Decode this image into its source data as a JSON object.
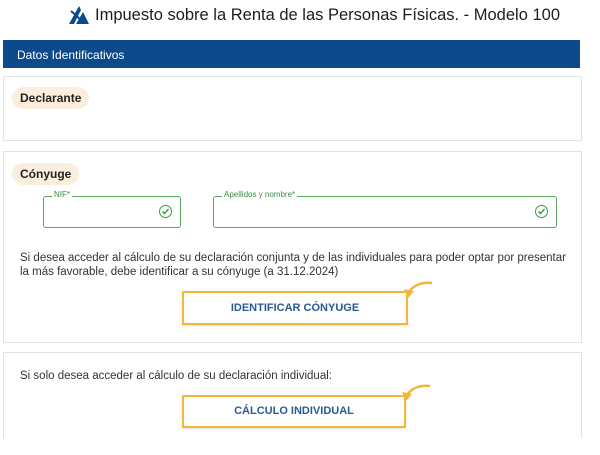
{
  "header": {
    "title": "Impuesto sobre la Renta de las Personas Físicas. - Modelo 100",
    "logo_icon": "aeat-logo"
  },
  "section": {
    "title": "Datos Identificativos"
  },
  "declarante": {
    "label": "Declarante"
  },
  "conyuge": {
    "label": "Cónyuge",
    "nif_label": "NIF*",
    "nif_value": "",
    "name_label": "Apellidos y nombre*",
    "name_value": "",
    "info_text": "Si desea acceder al cálculo de su declaración conjunta y de las individuales para poder optar por presentar la más favorable, debe identificar a su cónyuge (a 31.12.2024)",
    "button_label": "IDENTIFICAR CÓNYUGE"
  },
  "individual": {
    "info_text": "Si solo desea acceder al cálculo de su declaración individual:",
    "button_label": "CÁLCULO INDIVIDUAL"
  },
  "colors": {
    "brand_blue": "#0d4a8b",
    "highlight_yellow": "#f2b638",
    "field_green": "#57a55a",
    "pill_bg": "#fbeedd"
  }
}
